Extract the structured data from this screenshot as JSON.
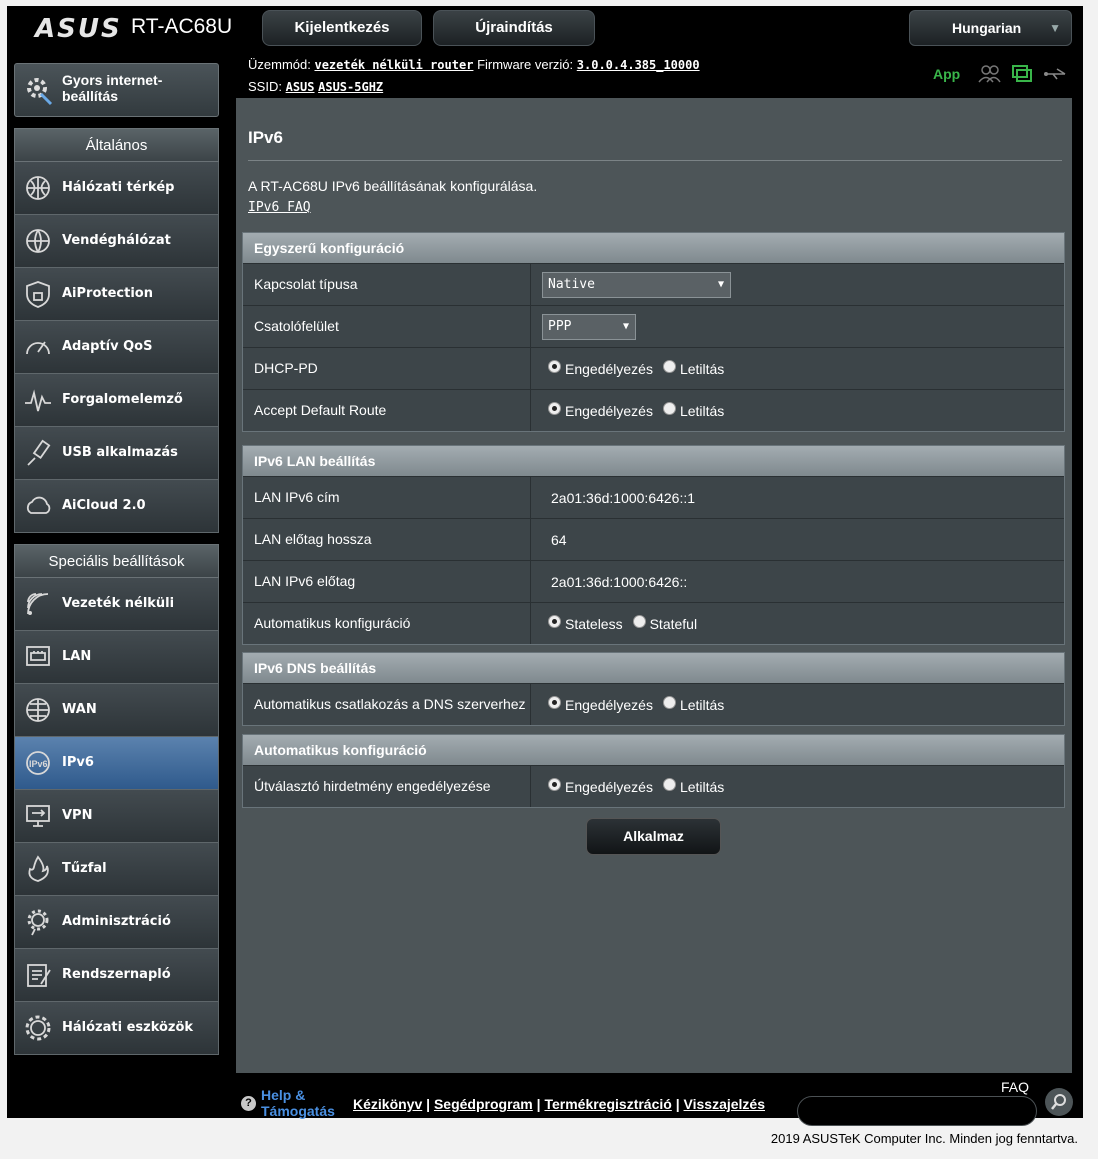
{
  "header": {
    "brand": "ASUS",
    "model": "RT-AC68U",
    "login_btn": "Kijelentkezés",
    "reboot_btn": "Újraindítás",
    "language": "Hungarian"
  },
  "status": {
    "mode_label": "Üzemmód:",
    "mode_value": "vezeték nélküli router",
    "fw_label": "Firmware verzió:",
    "fw_value": "3.0.0.4.385_10000",
    "ssid_label": "SSID:",
    "ssid_1": "ASUS",
    "ssid_2": "ASUS-5GHZ",
    "app": "App"
  },
  "sidebar": {
    "quick": "Gyors internet-beállítás",
    "general_head": "Általános",
    "general": [
      {
        "label": "Hálózati térkép",
        "icon": "globe-network-icon"
      },
      {
        "label": "Vendéghálózat",
        "icon": "guest-network-icon"
      },
      {
        "label": "AiProtection",
        "icon": "shield-lock-icon"
      },
      {
        "label": "Adaptív QoS",
        "icon": "gauge-icon"
      },
      {
        "label": "Forgalomelemző",
        "icon": "traffic-analyzer-icon"
      },
      {
        "label": "USB alkalmazás",
        "icon": "usb-icon"
      },
      {
        "label": "AiCloud 2.0",
        "icon": "cloud-icon"
      }
    ],
    "advanced_head": "Speciális beállítások",
    "advanced": [
      {
        "label": "Vezeték nélküli",
        "icon": "wifi-icon"
      },
      {
        "label": "LAN",
        "icon": "lan-icon"
      },
      {
        "label": "WAN",
        "icon": "wan-globe-icon"
      },
      {
        "label": "IPv6",
        "icon": "ipv6-icon"
      },
      {
        "label": "VPN",
        "icon": "vpn-icon"
      },
      {
        "label": "Tűzfal",
        "icon": "firewall-icon"
      },
      {
        "label": "Adminisztráció",
        "icon": "admin-gear-icon"
      },
      {
        "label": "Rendszernapló",
        "icon": "system-log-icon"
      },
      {
        "label": "Hálózati eszközök",
        "icon": "network-tools-icon"
      }
    ]
  },
  "main": {
    "title": "IPv6",
    "description": "A RT-AC68U IPv6 beállításának konfigurálása.",
    "faq_link": "IPv6 FAQ",
    "sections": {
      "basic": {
        "title": "Egyszerű konfiguráció",
        "conn_type_label": "Kapcsolat típusa",
        "conn_type_value": "Native",
        "interface_label": "Csatolófelület",
        "interface_value": "PPP",
        "dhcp_pd_label": "DHCP-PD",
        "accept_route_label": "Accept Default Route"
      },
      "lan": {
        "title": "IPv6 LAN beállítás",
        "addr_label": "LAN IPv6 cím",
        "addr_value": "2a01:36d:1000:6426::1",
        "prefix_len_label": "LAN előtag hossza",
        "prefix_len_value": "64",
        "prefix_label": "LAN IPv6 előtag",
        "prefix_value": "2a01:36d:1000:6426::",
        "autoconf_label": "Automatikus konfiguráció",
        "stateless": "Stateless",
        "stateful": "Stateful"
      },
      "dns": {
        "title": "IPv6 DNS beállítás",
        "auto_dns_label": "Automatikus csatlakozás a DNS szerverhez"
      },
      "auto": {
        "title": "Automatikus konfiguráció",
        "ra_label": "Útválasztó hirdetmény engedélyezése"
      }
    },
    "enable": "Engedélyezés",
    "disable": "Letiltás",
    "apply": "Alkalmaz"
  },
  "footer": {
    "help_1": "Help &",
    "help_2": "Támogatás",
    "manual": "Kézikönyv",
    "utility": "Segédprogram",
    "registration": "Termékregisztráció",
    "feedback": "Visszajelzés",
    "faq": "FAQ",
    "copyright": "2019 ASUSTeK Computer Inc. Minden jog fenntartva."
  },
  "colors": {
    "panel_bg": "#4d5558",
    "active_item": "#3f6b9d",
    "app_green": "#39b54a"
  }
}
